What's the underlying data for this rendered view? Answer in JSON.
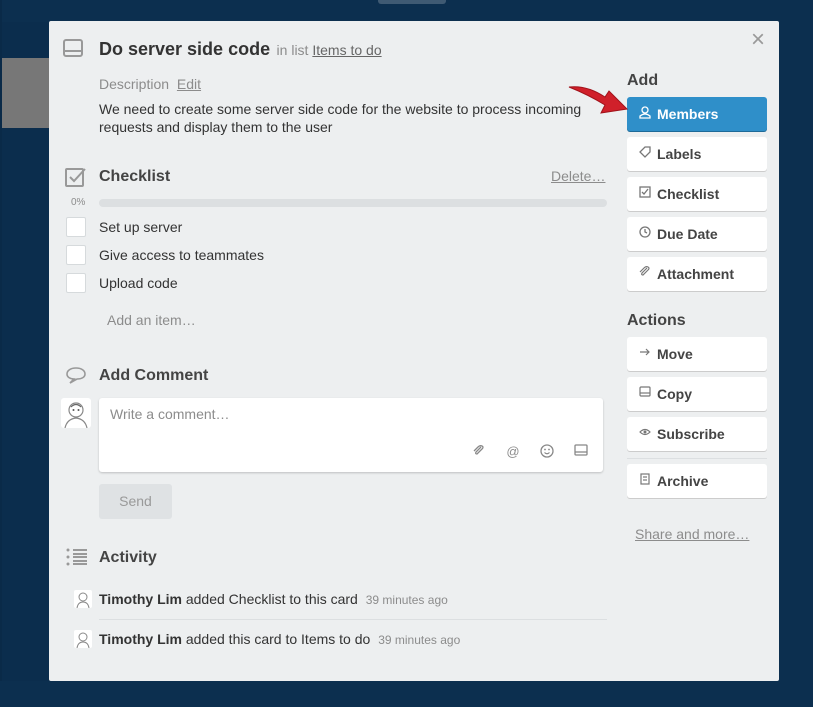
{
  "card": {
    "title": "Do server side code",
    "in_list_prefix": "in list",
    "list_name": "Items to do",
    "close_symbol": "×",
    "description_label": "Description",
    "description_edit": "Edit",
    "description_text": "We need to create some server side code for the website to process incoming requests and display them to the user"
  },
  "checklist": {
    "title": "Checklist",
    "delete_label": "Delete…",
    "progress_label": "0%",
    "progress": 0,
    "items": [
      {
        "label": "Set up server",
        "checked": false
      },
      {
        "label": "Give access to teammates",
        "checked": false
      },
      {
        "label": "Upload code",
        "checked": false
      }
    ],
    "add_item_label": "Add an item…"
  },
  "comment": {
    "title": "Add Comment",
    "placeholder": "Write a comment…",
    "send_label": "Send",
    "tools": [
      "attachment-icon",
      "mention-icon",
      "emoji-icon",
      "card-icon"
    ]
  },
  "activity": {
    "title": "Activity",
    "entries": [
      {
        "user": "Timothy Lim",
        "action": "added Checklist to this card",
        "time": "39 minutes ago"
      },
      {
        "user": "Timothy Lim",
        "action": "added this card to Items to do",
        "time": "39 minutes ago"
      }
    ]
  },
  "sidebar": {
    "add_heading": "Add",
    "add_buttons": [
      {
        "label": "Members",
        "icon": "person-icon",
        "primary": true
      },
      {
        "label": "Labels",
        "icon": "tag-icon"
      },
      {
        "label": "Checklist",
        "icon": "checkbox-icon"
      },
      {
        "label": "Due Date",
        "icon": "clock-icon"
      },
      {
        "label": "Attachment",
        "icon": "paperclip-icon"
      }
    ],
    "actions_heading": "Actions",
    "action_buttons": [
      {
        "label": "Move",
        "icon": "arrow-right-icon"
      },
      {
        "label": "Copy",
        "icon": "card-icon"
      },
      {
        "label": "Subscribe",
        "icon": "eye-icon"
      },
      {
        "label": "Archive",
        "icon": "archive-icon"
      }
    ],
    "share_label": "Share and more…"
  },
  "colors": {
    "primary_button": "#2f8fc9",
    "card_background": "#edeff0",
    "page_background": "#0b2d4d",
    "arrow": "#d0202a"
  }
}
